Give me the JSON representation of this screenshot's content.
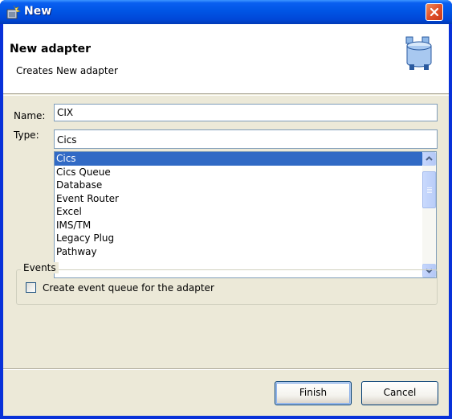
{
  "window": {
    "title": "New"
  },
  "header": {
    "title": "New adapter",
    "description": "Creates New adapter"
  },
  "form": {
    "name_label": "Name:",
    "name_value": "CIX",
    "type_label": "Type:",
    "type_value": "Cics"
  },
  "type_list": {
    "items": [
      "Cics",
      "Cics Queue",
      "Database",
      "Event Router",
      "Excel",
      "IMS/TM",
      "Legacy Plug",
      "Pathway"
    ],
    "selected": "Cics"
  },
  "events": {
    "legend": "Events",
    "checkbox_label": "Create event queue for the adapter",
    "checked": false
  },
  "buttons": {
    "finish": "Finish",
    "cancel": "Cancel"
  },
  "colors": {
    "titlebar": "#0055e5",
    "selection": "#316ac5",
    "close_button": "#e0502a",
    "dialog_bg": "#ece9d8"
  },
  "icons": {
    "title": "new-wizard-icon",
    "header": "adapter-cylinder-icon",
    "close": "close-icon"
  }
}
